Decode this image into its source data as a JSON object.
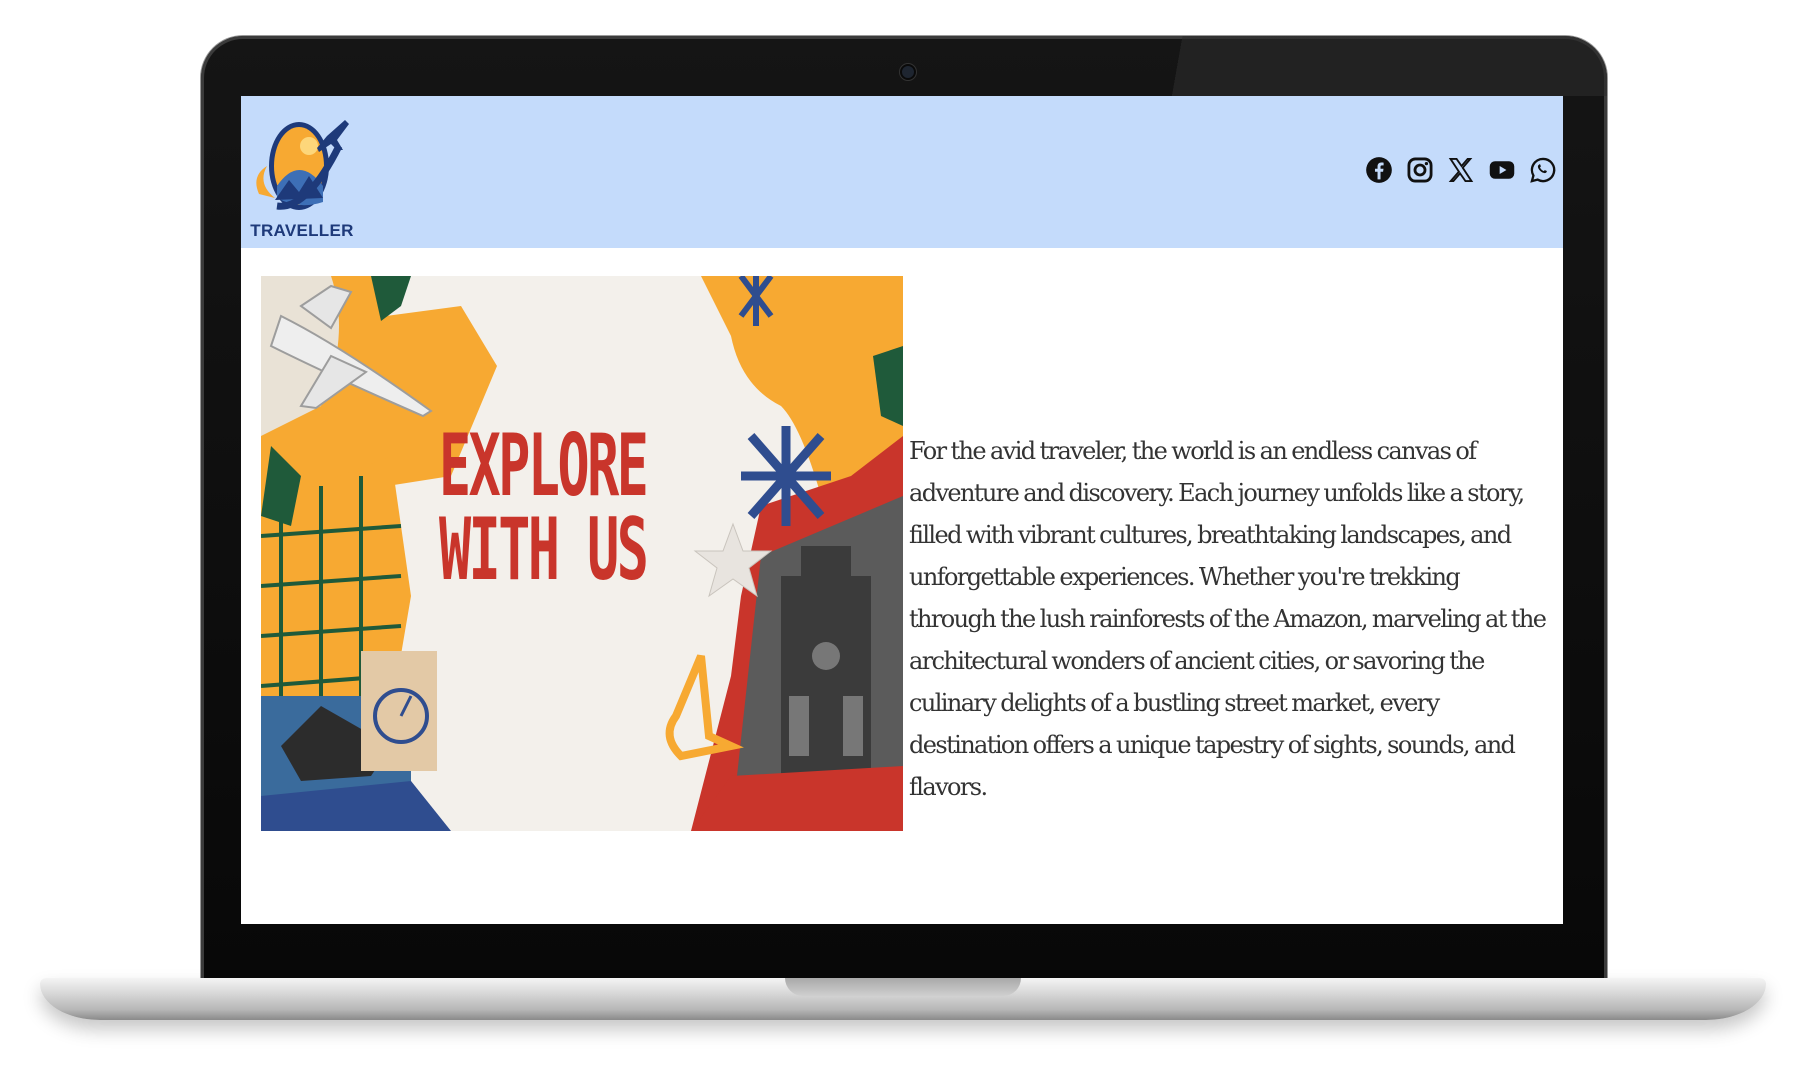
{
  "site": {
    "brand_name": "TRAVELLER"
  },
  "header": {
    "social_links": [
      {
        "name": "facebook-icon",
        "label": "Facebook"
      },
      {
        "name": "instagram-icon",
        "label": "Instagram"
      },
      {
        "name": "x-icon",
        "label": "X"
      },
      {
        "name": "youtube-icon",
        "label": "YouTube"
      },
      {
        "name": "whatsapp-icon",
        "label": "WhatsApp"
      }
    ]
  },
  "hero": {
    "banner_text": "EXPLORE\nWITH US",
    "paragraph": "For the avid traveler, the world is an endless canvas of adventure and discovery. Each journey unfolds like a story, filled with vibrant cultures, breathtaking landscapes, and unforgettable experiences. Whether you're trekking through the lush rainforests of the Amazon, marveling at the architectural wonders of ancient cities, or savoring the culinary delights of a bustling street market, every destination offers a unique tapestry of sights, sounds, and flavors."
  },
  "colors": {
    "header_bg": "#c4dbfb",
    "brand_text": "#1e3a7a",
    "banner_title": "#c9352b",
    "banner_orange": "#f7a932",
    "banner_blue": "#2f4d8f"
  }
}
